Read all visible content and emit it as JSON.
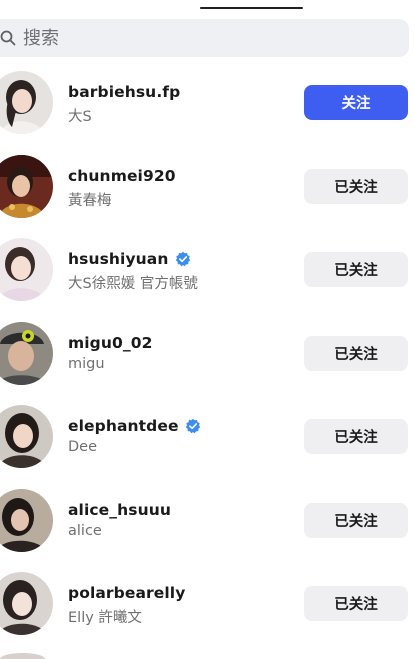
{
  "search": {
    "placeholder": "搜索",
    "icon": "search-icon"
  },
  "colors": {
    "accent": "#3d5ef0",
    "verified": "#3b8df0",
    "button_secondary": "#efeff1"
  },
  "users": [
    {
      "username": "barbiehsu.fp",
      "display_name": "大S",
      "verified": false,
      "button": "关注",
      "button_style": "primary"
    },
    {
      "username": "chunmei920",
      "display_name": "黃春梅",
      "verified": false,
      "button": "已关注",
      "button_style": "following"
    },
    {
      "username": "hsushiyuan",
      "display_name": "大S徐熙媛  官方帳號",
      "verified": true,
      "button": "已关注",
      "button_style": "following"
    },
    {
      "username": "migu0_02",
      "display_name": "migu",
      "verified": false,
      "button": "已关注",
      "button_style": "following"
    },
    {
      "username": "elephantdee",
      "display_name": "Dee",
      "verified": true,
      "button": "已关注",
      "button_style": "following"
    },
    {
      "username": "alice_hsuuu",
      "display_name": "alice",
      "verified": false,
      "button": "已关注",
      "button_style": "following"
    },
    {
      "username": "polarbearelly",
      "display_name": "Elly 許曦文",
      "verified": false,
      "button": "已关注",
      "button_style": "following"
    }
  ]
}
